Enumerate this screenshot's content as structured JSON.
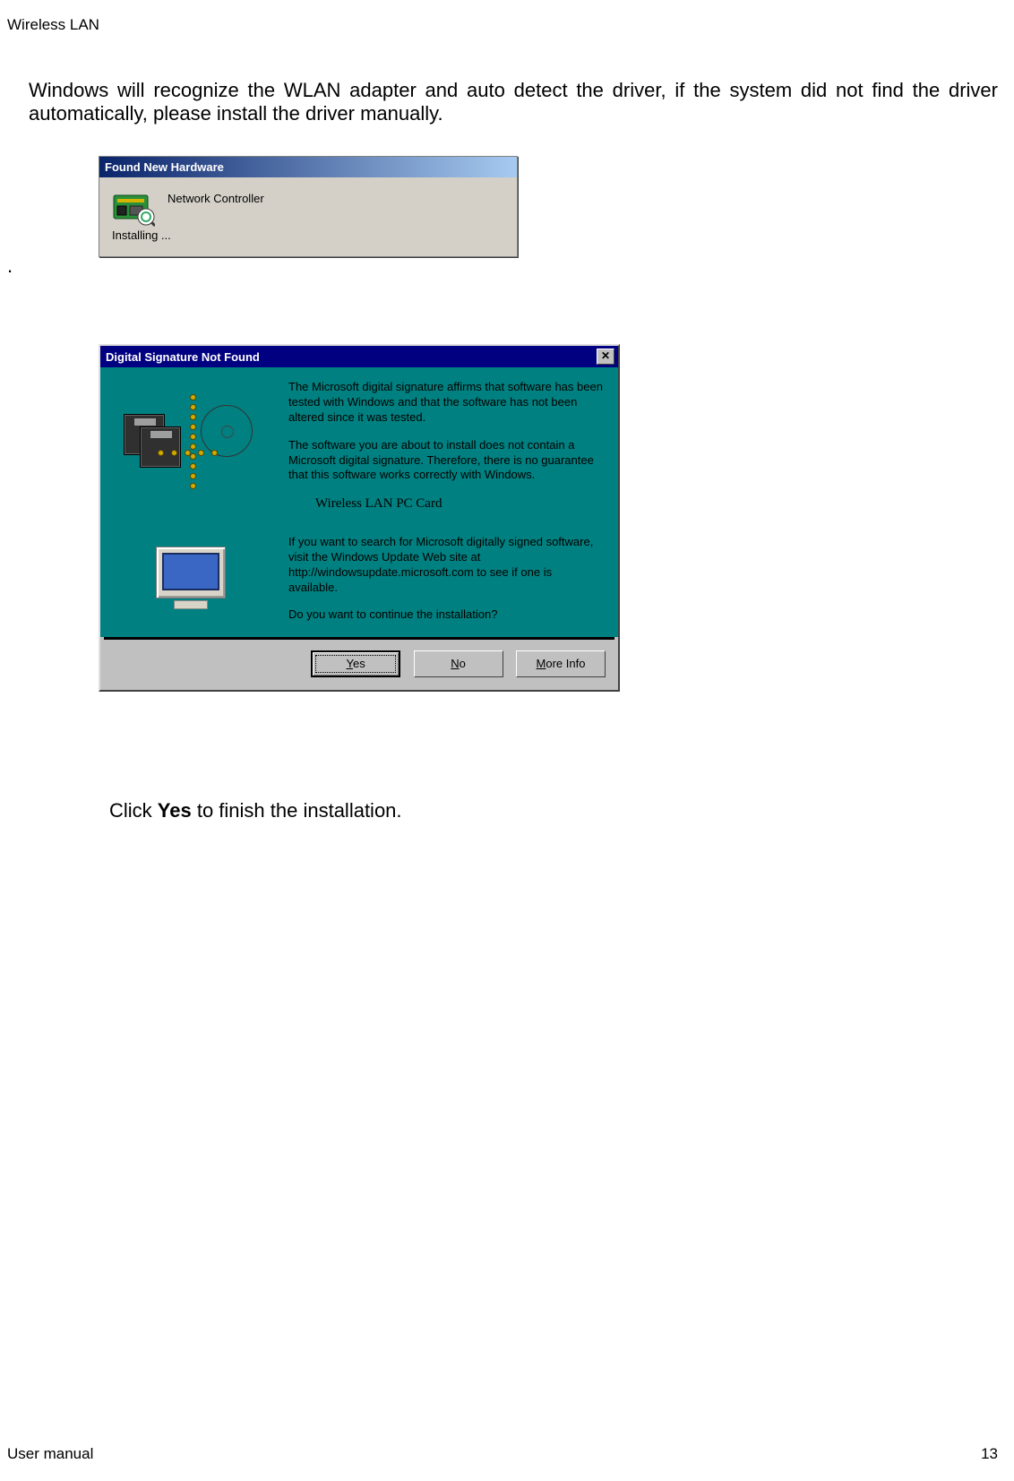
{
  "header": "Wireless LAN",
  "intro_paragraph": "Windows will recognize the WLAN adapter and auto detect the driver, if the system did not find the driver automatically, please install the driver manually.",
  "period": ".",
  "fnh": {
    "title": "Found New Hardware",
    "device": "Network Controller",
    "status": "Installing ..."
  },
  "dsig": {
    "title": "Digital Signature Not Found",
    "close_glyph": "✕",
    "para1": "The Microsoft digital signature affirms that software has been tested with Windows and that the software has not been altered since it was tested.",
    "para2": "The software you are about to install does not contain a Microsoft digital signature. Therefore,  there is no guarantee that this software works correctly with Windows.",
    "device_name": "Wireless LAN PC Card",
    "para3": "If you want to search for Microsoft digitally signed software, visit the Windows Update Web site at http://windowsupdate.microsoft.com to see if one is available.",
    "para4": "Do you want to continue the installation?",
    "buttons": {
      "yes_pre": "",
      "yes_u": "Y",
      "yes_post": "es",
      "no_pre": "",
      "no_u": "N",
      "no_post": "o",
      "more_pre": "",
      "more_u": "M",
      "more_post": "ore Info"
    }
  },
  "instruction": {
    "pre": "Click ",
    "bold": "Yes",
    "post": " to finish the installation."
  },
  "footer": {
    "left": "User manual",
    "right": "13"
  }
}
